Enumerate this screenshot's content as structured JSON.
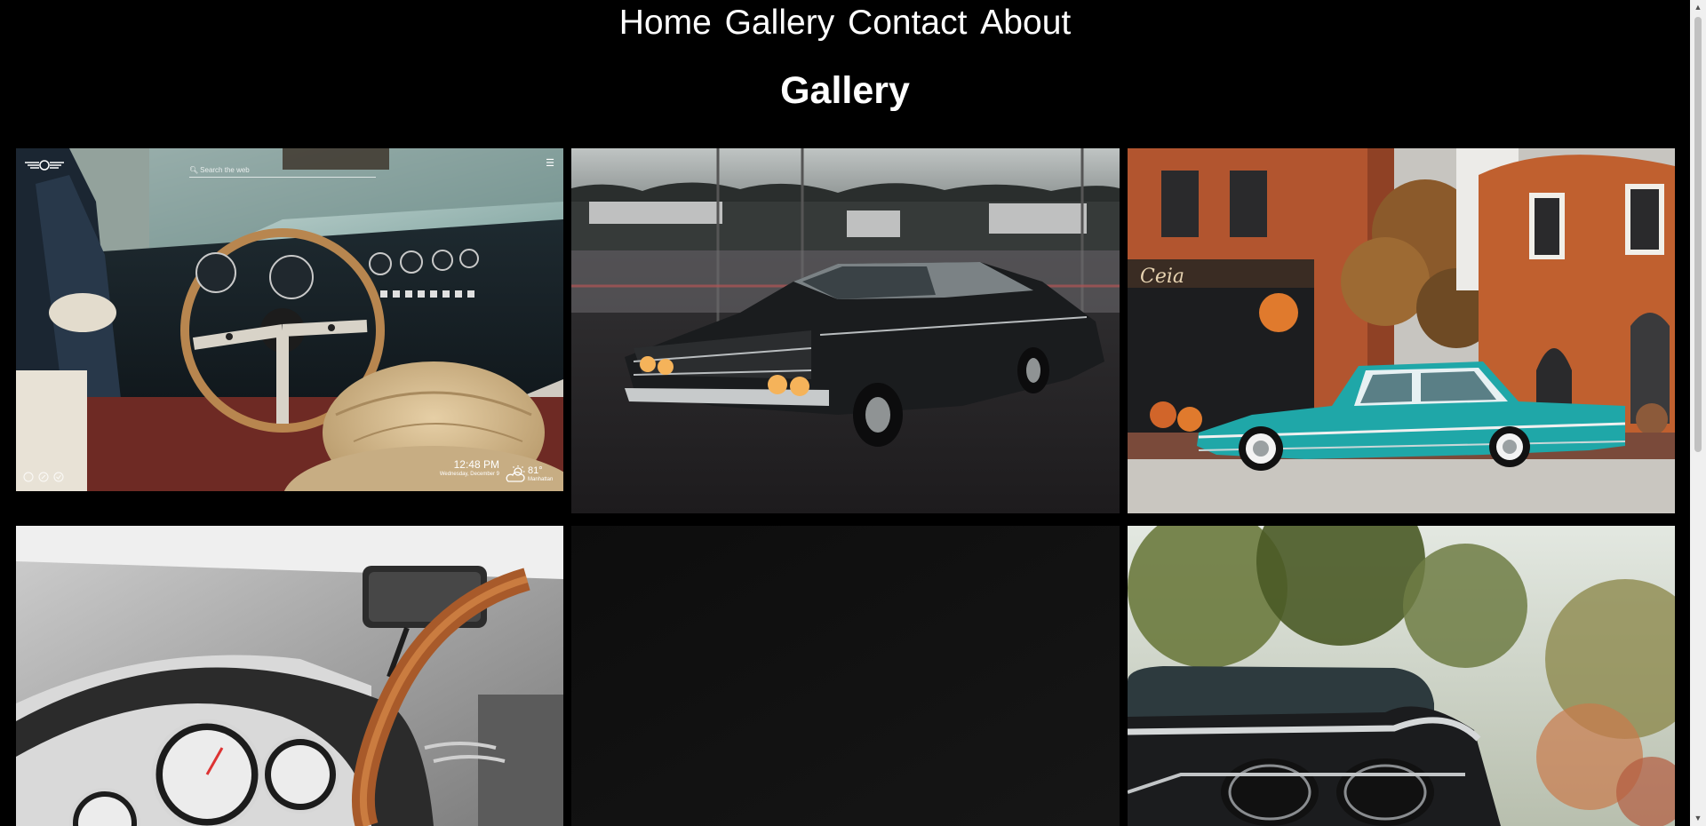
{
  "nav": {
    "items": [
      {
        "label": "Home"
      },
      {
        "label": "Gallery"
      },
      {
        "label": "Contact"
      },
      {
        "label": "About"
      }
    ]
  },
  "page": {
    "title": "Gallery"
  },
  "gallery": {
    "tile1_overlay": {
      "search_placeholder": "Search the web",
      "time": "12:48 PM",
      "date": "Wednesday, December 9",
      "temperature": "81°",
      "location": "Manhattan"
    }
  },
  "colors": {
    "background": "#000000",
    "text": "#ffffff",
    "scrollbar_track": "#f0f0f0",
    "scrollbar_thumb": "#c1c1c1",
    "teal_car": "#1fa7a8",
    "brick": "#b2552f"
  },
  "icons": {
    "search": "search-icon",
    "menu": "menu-icon",
    "weather": "partly-cloudy-icon",
    "logo": "mini-wings-logo"
  }
}
